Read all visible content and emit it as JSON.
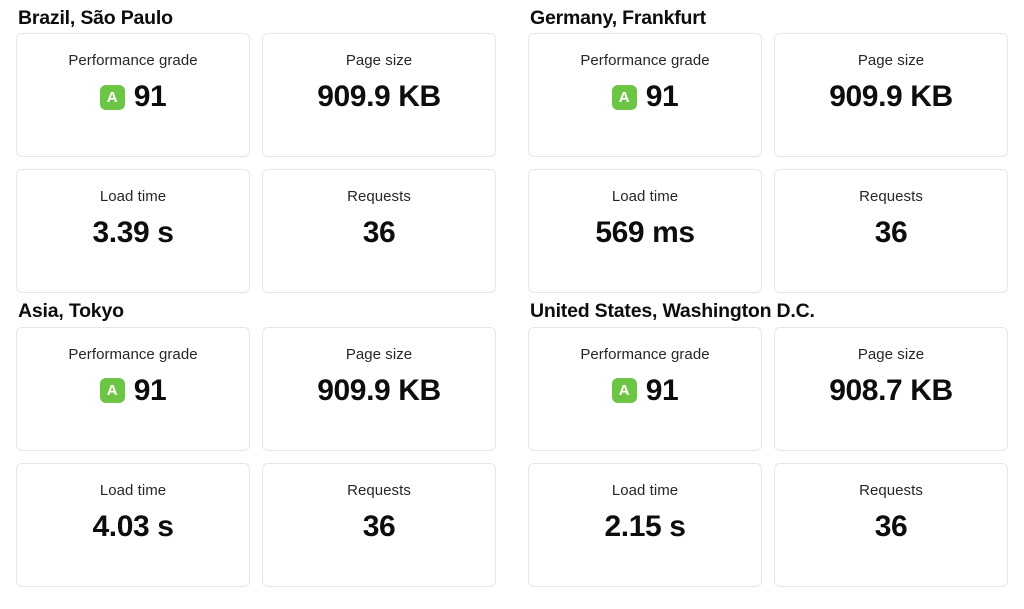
{
  "theme": {
    "background": "#ffffff",
    "card_background": "#ffffff",
    "card_border": "#e6e6e6",
    "text": "#0d0d0d",
    "label_text": "#262626",
    "grade_badge_background": "#6cc644",
    "grade_badge_text": "#ffffff"
  },
  "labels": {
    "performance_grade": "Performance grade",
    "page_size": "Page size",
    "load_time": "Load time",
    "requests": "Requests"
  },
  "locations": [
    {
      "title": "Brazil, São Paulo",
      "performance_grade": {
        "letter": "A",
        "score": "91"
      },
      "page_size": "909.9 KB",
      "load_time": "3.39 s",
      "requests": "36"
    },
    {
      "title": "Germany, Frankfurt",
      "performance_grade": {
        "letter": "A",
        "score": "91"
      },
      "page_size": "909.9 KB",
      "load_time": "569 ms",
      "requests": "36"
    },
    {
      "title": "Asia, Tokyo",
      "performance_grade": {
        "letter": "A",
        "score": "91"
      },
      "page_size": "909.9 KB",
      "load_time": "4.03 s",
      "requests": "36"
    },
    {
      "title": "United States, Washington D.C.",
      "performance_grade": {
        "letter": "A",
        "score": "91"
      },
      "page_size": "908.7 KB",
      "load_time": "2.15 s",
      "requests": "36"
    }
  ]
}
